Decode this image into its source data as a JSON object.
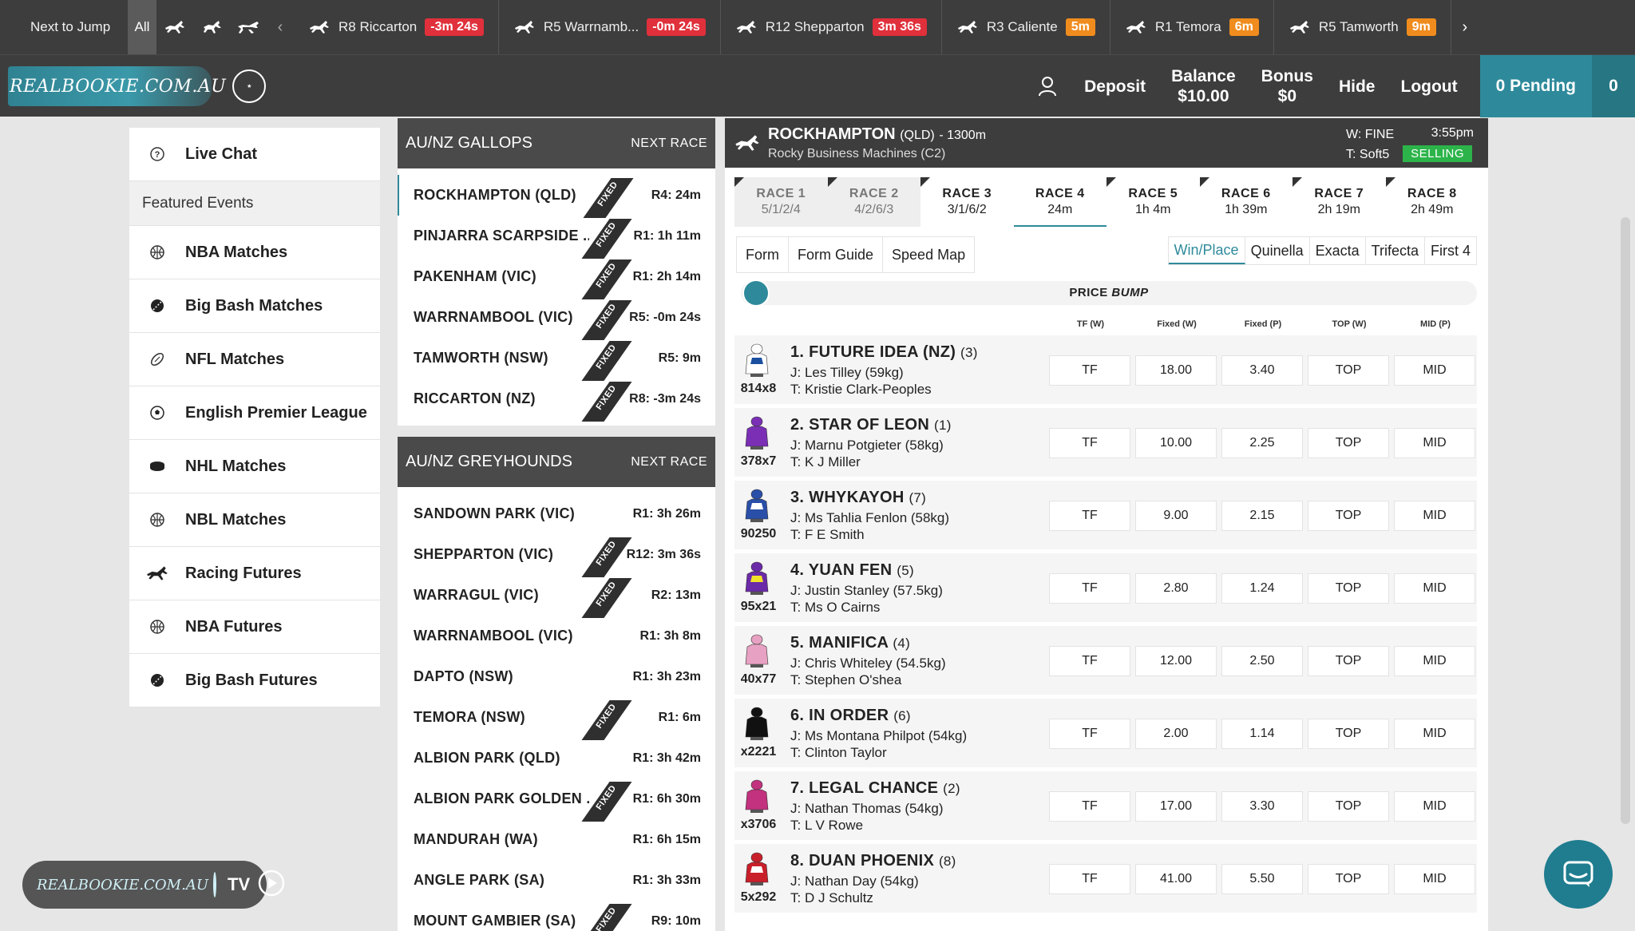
{
  "ntj": {
    "label": "Next to Jump",
    "all": "All",
    "items": [
      {
        "name": "R8  Riccarton",
        "time": "-3m 24s",
        "color": "red"
      },
      {
        "name": "R5  Warrnamb...",
        "time": "-0m 24s",
        "color": "red"
      },
      {
        "name": "R12  Shepparton",
        "time": "3m 36s",
        "color": "red"
      },
      {
        "name": "R3  Caliente",
        "time": "5m",
        "color": "orange"
      },
      {
        "name": "R1  Temora",
        "time": "6m",
        "color": "orange"
      },
      {
        "name": "R5  Tamworth",
        "time": "9m",
        "color": "orange"
      }
    ]
  },
  "header": {
    "logo": "REALBOOKIE.COM.AU",
    "deposit": "Deposit",
    "balance_label": "Balance",
    "balance_value": "$10.00",
    "bonus_label": "Bonus",
    "bonus_value": "$0",
    "hide": "Hide",
    "logout": "Logout",
    "pending": "0 Pending",
    "count": "0"
  },
  "sidebar": {
    "live_chat": "Live Chat",
    "featured": "Featured Events",
    "items": [
      {
        "label": "NBA Matches",
        "icon": "basketball-icon"
      },
      {
        "label": "Big Bash Matches",
        "icon": "cricket-icon"
      },
      {
        "label": "NFL Matches",
        "icon": "football-icon"
      },
      {
        "label": "English Premier League",
        "icon": "soccer-icon"
      },
      {
        "label": "NHL Matches",
        "icon": "puck-icon"
      },
      {
        "label": "NBL Matches",
        "icon": "basketball-icon"
      },
      {
        "label": "Racing Futures",
        "icon": "horse-icon"
      },
      {
        "label": "NBA Futures",
        "icon": "basketball-icon"
      },
      {
        "label": "Big Bash Futures",
        "icon": "cricket-icon"
      }
    ]
  },
  "gallops": {
    "title": "AU/NZ GALLOPS",
    "next": "NEXT RACE",
    "rows": [
      {
        "name": "ROCKHAMPTON (QLD)",
        "time": "R4: 24m",
        "fixed": true
      },
      {
        "name": "PINJARRA SCARPSIDE ...",
        "time": "R1: 1h 11m",
        "fixed": true
      },
      {
        "name": "PAKENHAM (VIC)",
        "time": "R1: 2h 14m",
        "fixed": true
      },
      {
        "name": "WARRNAMBOOL (VIC)",
        "time": "R5: -0m 24s",
        "fixed": true
      },
      {
        "name": "TAMWORTH (NSW)",
        "time": "R5: 9m",
        "fixed": true
      },
      {
        "name": "RICCARTON (NZ)",
        "time": "R8: -3m 24s",
        "fixed": true
      }
    ]
  },
  "greyhounds": {
    "title": "AU/NZ GREYHOUNDS",
    "next": "NEXT RACE",
    "rows": [
      {
        "name": "SANDOWN PARK (VIC)",
        "time": "R1: 3h 26m",
        "fixed": false
      },
      {
        "name": "SHEPPARTON (VIC)",
        "time": "R12: 3m 36s",
        "fixed": true
      },
      {
        "name": "WARRAGUL (VIC)",
        "time": "R2: 13m",
        "fixed": true
      },
      {
        "name": "WARRNAMBOOL (VIC)",
        "time": "R1: 3h 8m",
        "fixed": false
      },
      {
        "name": "DAPTO (NSW)",
        "time": "R1: 3h 23m",
        "fixed": false
      },
      {
        "name": "TEMORA (NSW)",
        "time": "R1: 6m",
        "fixed": true
      },
      {
        "name": "ALBION PARK (QLD)",
        "time": "R1: 3h 42m",
        "fixed": false
      },
      {
        "name": "ALBION PARK GOLDEN ...",
        "time": "R1: 6h 30m",
        "fixed": true
      },
      {
        "name": "MANDURAH (WA)",
        "time": "R1: 6h 15m",
        "fixed": false
      },
      {
        "name": "ANGLE PARK (SA)",
        "time": "R1: 3h 33m",
        "fixed": false
      },
      {
        "name": "MOUNT GAMBIER (SA)",
        "time": "R9: 10m",
        "fixed": true
      }
    ],
    "fixed_label": "FIXED"
  },
  "race": {
    "venue": "ROCKHAMPTON",
    "state": "(QLD)",
    "distance": "- 1300m",
    "sub": "Rocky Business Machines (C2)",
    "weather": "W: FINE",
    "track": "T: Soft5",
    "time": "3:55pm",
    "status": "SELLING",
    "tabs": [
      {
        "l1": "RACE 1",
        "l2": "5/1/2/4",
        "state": "done"
      },
      {
        "l1": "RACE 2",
        "l2": "4/2/6/3",
        "state": "done"
      },
      {
        "l1": "RACE 3",
        "l2": "3/1/6/2",
        "state": "normal"
      },
      {
        "l1": "RACE 4",
        "l2": "24m",
        "state": "active"
      },
      {
        "l1": "RACE 5",
        "l2": "1h 4m",
        "state": "normal"
      },
      {
        "l1": "RACE 6",
        "l2": "1h 39m",
        "state": "normal"
      },
      {
        "l1": "RACE 7",
        "l2": "2h 19m",
        "state": "normal"
      },
      {
        "l1": "RACE 8",
        "l2": "2h 49m",
        "state": "normal"
      }
    ],
    "subtabs_left": [
      "Form",
      "Form Guide",
      "Speed Map"
    ],
    "subtabs_right": [
      "Win/Place",
      "Quinella",
      "Exacta",
      "Trifecta",
      "First 4"
    ],
    "bump_label": "PRICE",
    "bump_italic": "BUMP",
    "cols": [
      "TF (W)",
      "Fixed (W)",
      "Fixed (P)",
      "TOP (W)",
      "MID (P)"
    ],
    "runners": [
      {
        "name": "1. FUTURE IDEA (NZ)",
        "barrier": "(3)",
        "jockey": "J: Les Tilley (59kg)",
        "trainer": "T: Kristie Clark-Peoples",
        "form": "814x8",
        "tf": "TF",
        "win": "18.00",
        "place": "3.40",
        "top": "TOP",
        "mid": "MID",
        "silk": "silk-stripes-icon"
      },
      {
        "name": "2. STAR OF LEON",
        "barrier": "(1)",
        "jockey": "J: Marnu Potgieter (58kg)",
        "trainer": "T: K J Miller",
        "form": "378x7",
        "tf": "TF",
        "win": "10.00",
        "place": "2.25",
        "top": "TOP",
        "mid": "MID",
        "silk": "silk-purple-icon"
      },
      {
        "name": "3. WHYKAYOH",
        "barrier": "(7)",
        "jockey": "J: Ms Tahlia Fenlon (58kg)",
        "trainer": "T: F E Smith",
        "form": "90250",
        "tf": "TF",
        "win": "9.00",
        "place": "2.15",
        "top": "TOP",
        "mid": "MID",
        "silk": "silk-blue-hoops-icon"
      },
      {
        "name": "4. YUAN FEN",
        "barrier": "(5)",
        "jockey": "J: Justin Stanley (57.5kg)",
        "trainer": "T: Ms O Cairns",
        "form": "95x21",
        "tf": "TF",
        "win": "2.80",
        "place": "1.24",
        "top": "TOP",
        "mid": "MID",
        "silk": "silk-purple-yellow-icon"
      },
      {
        "name": "5. MANIFICA",
        "barrier": "(4)",
        "jockey": "J: Chris Whiteley (54.5kg)",
        "trainer": "T: Stephen O'shea",
        "form": "40x77",
        "tf": "TF",
        "win": "12.00",
        "place": "2.50",
        "top": "TOP",
        "mid": "MID",
        "silk": "silk-pink-icon"
      },
      {
        "name": "6. IN ORDER",
        "barrier": "(6)",
        "jockey": "J: Ms Montana Philpot (54kg)",
        "trainer": "T: Clinton Taylor",
        "form": "x2221",
        "tf": "TF",
        "win": "2.00",
        "place": "1.14",
        "top": "TOP",
        "mid": "MID",
        "silk": "silk-black-icon"
      },
      {
        "name": "7. LEGAL CHANCE",
        "barrier": "(2)",
        "jockey": "J: Nathan Thomas (54kg)",
        "trainer": "T: L V Rowe",
        "form": "x3706",
        "tf": "TF",
        "win": "17.00",
        "place": "3.30",
        "top": "TOP",
        "mid": "MID",
        "silk": "silk-magenta-icon"
      },
      {
        "name": "8. DUAN PHOENIX",
        "barrier": "(8)",
        "jockey": "J: Nathan Day (54kg)",
        "trainer": "T: D J Schultz",
        "form": "5x292",
        "tf": "TF",
        "win": "41.00",
        "place": "5.50",
        "top": "TOP",
        "mid": "MID",
        "silk": "silk-red-white-icon"
      }
    ]
  },
  "tv": {
    "logo": "REALBOOKIE.COM.AU",
    "label": "TV"
  },
  "colors": {
    "accent": "#2e8a9b",
    "dark": "#3d3d3d",
    "red": "#e0303b",
    "orange": "#f08c1e",
    "selling": "#2cb44a"
  }
}
